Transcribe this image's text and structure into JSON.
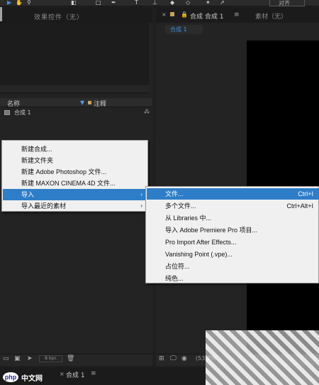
{
  "project_panel": {
    "effects_tab_label": "效果控件（无）",
    "col_name": "名称",
    "col_note": "注释",
    "comp_item": "合成 1",
    "bpc": "8 bpc"
  },
  "viewer_panel": {
    "tab_label": "合成 合成 1",
    "footage_tab": "素材（无）",
    "subtab": "合成 1",
    "zoom": "(53.7%"
  },
  "timeline": {
    "tab_label": "合成 1"
  },
  "toolbar": {
    "workspace": "对齐"
  },
  "context_menu": {
    "items": [
      "新建合成...",
      "新建文件夹",
      "新建 Adobe Photoshop 文件...",
      "新建 MAXON CINEMA 4D 文件...",
      "导入",
      "导入最近的素材"
    ]
  },
  "import_submenu": {
    "items": [
      {
        "label": "文件...",
        "shortcut": "Ctrl+I"
      },
      {
        "label": "多个文件...",
        "shortcut": "Ctrl+Alt+I"
      },
      {
        "label": "从 Libraries 中..."
      },
      {
        "label": "导入 Adobe Premiere Pro 项目..."
      },
      {
        "label": "Pro Import After Effects..."
      },
      {
        "label": "Vanishing Point (.vpe)..."
      },
      {
        "label": "占位符..."
      },
      {
        "label": "纯色..."
      }
    ]
  },
  "watermark": {
    "logo": "php",
    "text": "中文网"
  },
  "colors": {
    "accent": "#2e7dc8",
    "panel": "#232323",
    "menu_bg": "#f0f0f0"
  }
}
